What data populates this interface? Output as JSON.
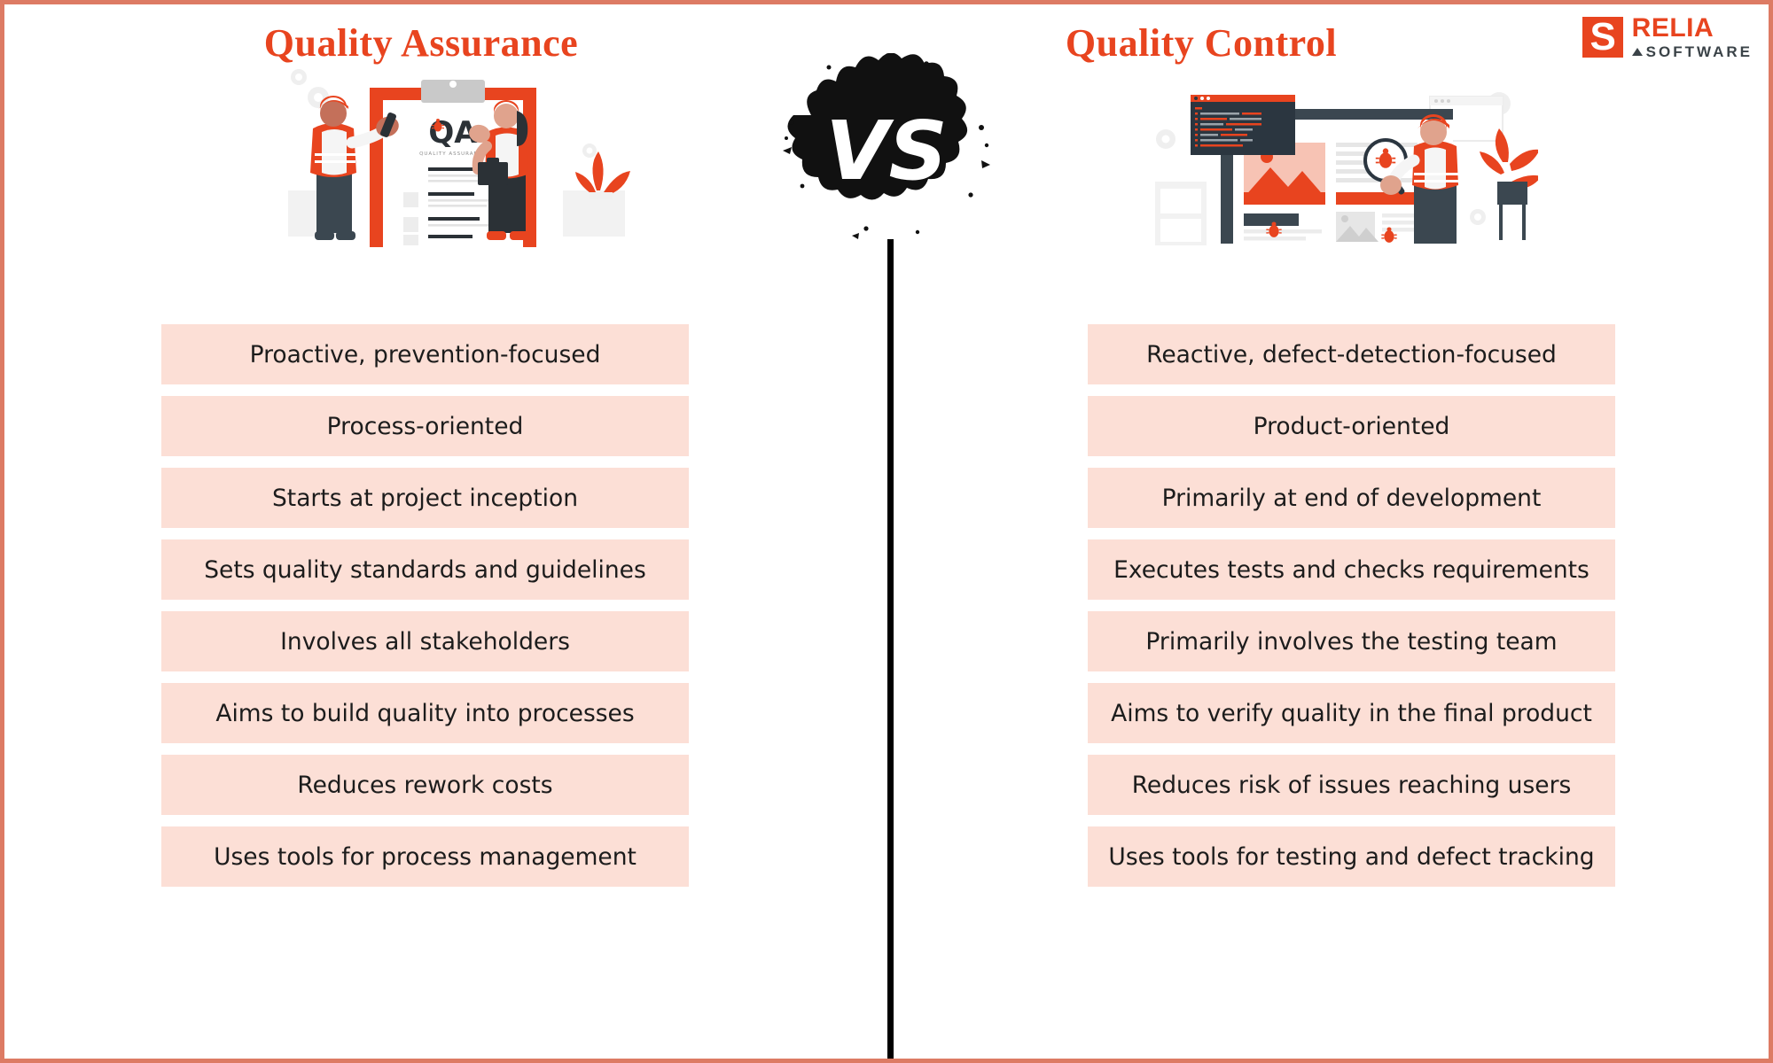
{
  "brand": {
    "logo_mark_letter": "S",
    "name": "RELIA",
    "subtitle": "SOFTWARE",
    "accent_color": "#e8441f",
    "dark_color": "#3b4348"
  },
  "colors": {
    "frame_border": "#dd7b64",
    "title": "#e8441f",
    "row_background": "#fcdfd6",
    "row_text": "#1c1c1c",
    "divider": "#000000",
    "vs_badge": "#111111"
  },
  "center": {
    "vs_label": "VS"
  },
  "left_column": {
    "title": "Quality Assurance",
    "illustration": "qa-clipboard-illustration",
    "rows": [
      "Proactive, prevention-focused",
      "Process-oriented",
      "Starts at project inception",
      "Sets quality standards and guidelines",
      "Involves all stakeholders",
      "Aims to build quality into processes",
      "Reduces rework costs",
      "Uses tools for process management"
    ]
  },
  "right_column": {
    "title": "Quality Control",
    "illustration": "qc-monitor-bug-illustration",
    "rows": [
      "Reactive, defect-detection-focused",
      "Product-oriented",
      "Primarily at end of development",
      "Executes tests and checks requirements",
      "Primarily involves the testing team",
      "Aims to verify quality in the final product",
      "Reduces risk of issues reaching users",
      "Uses tools for testing and defect tracking"
    ]
  }
}
